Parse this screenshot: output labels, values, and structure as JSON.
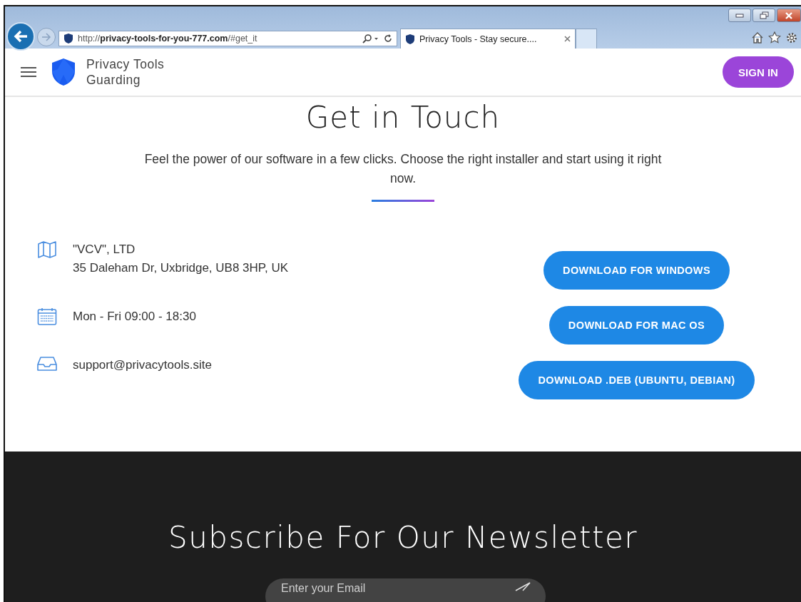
{
  "browser": {
    "address": "http://**privacy-tools-for-you-777.com**/#get_it",
    "tabs": [
      {
        "title": "Privacy Tools - Stay secure....",
        "selected": true
      }
    ]
  },
  "header": {
    "brand_lines": [
      "Privacy Tools",
      "Guarding"
    ],
    "sign_in": "SIGN IN"
  },
  "contact": {
    "title": "Get in Touch",
    "subtitle": "Feel the power of our software in a few clicks. Choose the right installer and start using it right now.",
    "items": [
      {
        "kind": "address",
        "lines": [
          "\"VCV\", LTD",
          "35 Daleham Dr, Uxbridge, UB8 3HP, UK"
        ]
      },
      {
        "kind": "hours",
        "lines": [
          "Mon - Fri 09:00 - 18:30"
        ]
      },
      {
        "kind": "email",
        "lines": [
          "support@privacytools.site"
        ]
      }
    ],
    "downloads": [
      "DOWNLOAD FOR WINDOWS",
      "DOWNLOAD FOR MAC OS",
      "DOWNLOAD .DEB (UBUNTU, DEBIAN)"
    ]
  },
  "newsletter": {
    "title": "Subscribe For Our Newsletter",
    "email_placeholder": "Enter your Email"
  }
}
